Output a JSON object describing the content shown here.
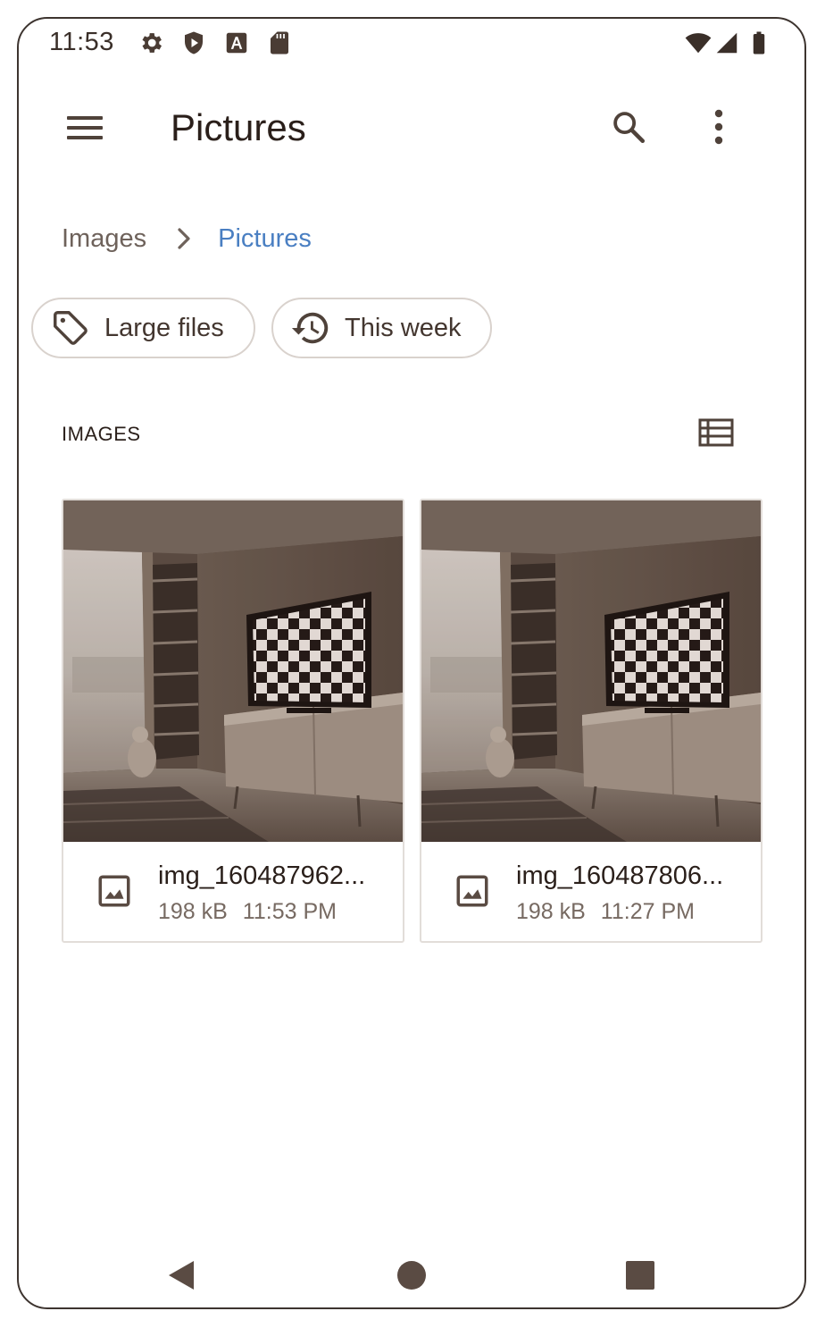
{
  "status_bar": {
    "time": "11:53",
    "left_icons": [
      "settings-icon",
      "shield-play-icon",
      "font-a-icon",
      "sd-card-icon"
    ],
    "right_icons": [
      "wifi-icon",
      "signal-icon",
      "battery-icon"
    ]
  },
  "app_bar": {
    "title": "Pictures",
    "menu_icon": "hamburger-menu-icon",
    "search_icon": "search-icon",
    "more_icon": "more-vert-icon"
  },
  "breadcrumb": {
    "items": [
      "Images",
      "Pictures"
    ],
    "separator_icon": "chevron-right-icon"
  },
  "chips": [
    {
      "label": "Large files",
      "icon": "label-tag-icon"
    },
    {
      "label": "This week",
      "icon": "history-icon"
    }
  ],
  "section": {
    "title": "IMAGES",
    "view_toggle_icon": "list-view-icon"
  },
  "files": [
    {
      "name": "img_160487962...",
      "size": "198 kB",
      "time": "11:53 PM",
      "icon": "image-file-icon"
    },
    {
      "name": "img_160487806...",
      "size": "198 kB",
      "time": "11:27 PM",
      "icon": "image-file-icon"
    }
  ],
  "nav_bar": {
    "back_icon": "back-triangle-icon",
    "home_icon": "home-circle-icon",
    "recents_icon": "recents-square-icon"
  },
  "colors": {
    "accent": "#4a7fc2",
    "text_primary": "#2a1f1a",
    "text_secondary": "#776a62",
    "icon": "#5a4b43"
  }
}
